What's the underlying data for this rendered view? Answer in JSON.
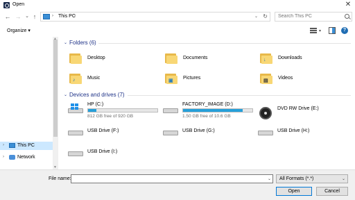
{
  "window": {
    "title": "Open",
    "close_glyph": "✕"
  },
  "nav": {
    "back_glyph": "←",
    "forward_glyph": "→",
    "dropdown_glyph": "⌄",
    "up_glyph": "↑",
    "breadcrumb": [
      "This PC"
    ],
    "search_placeholder": "Search This PC"
  },
  "toolbar": {
    "organize_label": "Organize ▾"
  },
  "sidebar": {
    "items": [
      {
        "label": "This PC",
        "icon": "pc-icon",
        "selected": true
      },
      {
        "label": "Network",
        "icon": "network-icon",
        "selected": false
      }
    ]
  },
  "folders": {
    "header": "Folders (6)",
    "items": [
      {
        "label": "Desktop",
        "icon": "desktop-folder-icon"
      },
      {
        "label": "Documents",
        "icon": "documents-folder-icon"
      },
      {
        "label": "Downloads",
        "icon": "downloads-folder-icon"
      },
      {
        "label": "Music",
        "icon": "music-folder-icon"
      },
      {
        "label": "Pictures",
        "icon": "pictures-folder-icon"
      },
      {
        "label": "Videos",
        "icon": "videos-folder-icon"
      }
    ]
  },
  "drives": {
    "header": "Devices and drives (7)",
    "items": [
      {
        "name": "HP (C:)",
        "free": "812 GB free of 920 GB",
        "used_fraction": 0.12,
        "icon": "windows-drive-icon"
      },
      {
        "name": "FACTORY_IMAGE (D:)",
        "free": "1.50 GB free of 10.6 GB",
        "used_fraction": 0.86,
        "icon": "drive-icon"
      },
      {
        "name": "DVD RW Drive (E:)",
        "icon": "dvd-drive-icon"
      },
      {
        "name": "USB Drive (F:)",
        "icon": "usb-drive-icon"
      },
      {
        "name": "USB Drive (G:)",
        "icon": "usb-drive-icon"
      },
      {
        "name": "USB Drive (H:)",
        "icon": "usb-drive-icon"
      },
      {
        "name": "USB Drive (I:)",
        "icon": "usb-drive-icon"
      }
    ]
  },
  "footer": {
    "filename_label": "File name:",
    "filename_value": "",
    "filetype_value": "All Formats (*.*)",
    "open_label": "Open",
    "cancel_label": "Cancel"
  }
}
